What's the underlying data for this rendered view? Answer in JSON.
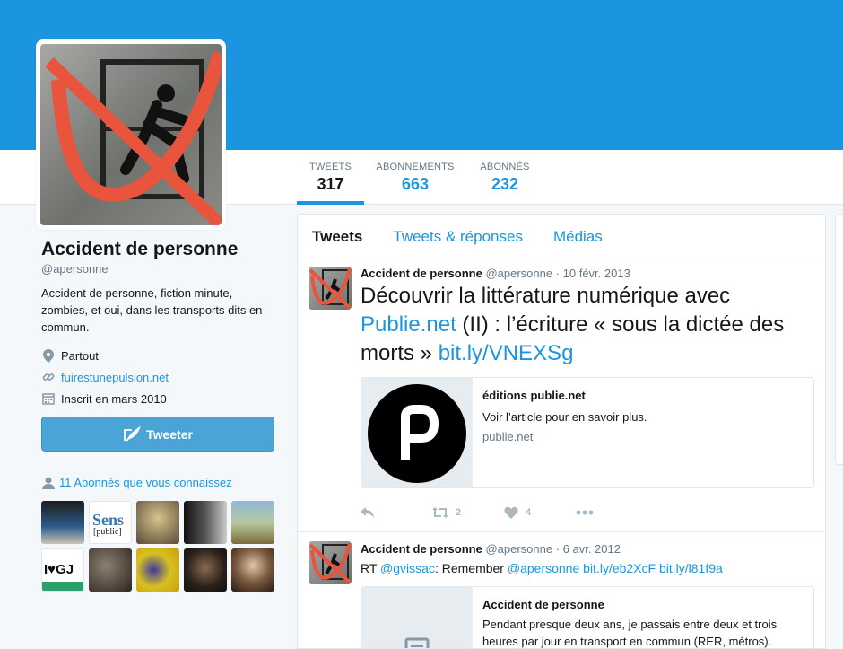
{
  "colors": {
    "brand": "#1b95e0",
    "banner": "#1b95e0",
    "button": "#4aa4d6"
  },
  "nav": {
    "tweets_label": "TWEETS",
    "tweets_count": "317",
    "following_label": "ABONNEMENTS",
    "following_count": "663",
    "followers_label": "ABONNÉS",
    "followers_count": "232"
  },
  "profile": {
    "name": "Accident de personne",
    "handle": "@apersonne",
    "bio": "Accident de personne, fiction minute, zombies, et oui, dans les transports dits en commun.",
    "location": "Partout",
    "website": "fuirestunepulsion.net",
    "joined": "Inscrit en mars 2010",
    "tweet_button": "Tweeter",
    "known_followers": "11 Abonnés que vous connaissez"
  },
  "thumb_texts": {
    "sens": "Sens",
    "public": "[public]",
    "ilove": "I♥GJ"
  },
  "tabs": [
    "Tweets",
    "Tweets & réponses",
    "Médias"
  ],
  "tweets": [
    {
      "name": "Accident de personne",
      "handle": "@apersonne",
      "date": "· 10 févr. 2013",
      "text1": "Découvrir la littérature numérique avec ",
      "link1": "Publie.net",
      "text2": " (II) : l’écriture « sous la dictée des morts » ",
      "link2": "bit.ly/VNEXSg",
      "card": {
        "title": "éditions publie.net",
        "desc": "Voir l’article pour en savoir plus.",
        "url": "publie.net"
      },
      "retweets": "2",
      "likes": "4"
    },
    {
      "name": "Accident de personne",
      "handle": "@apersonne",
      "date": "· 6 avr. 2012",
      "rt": "RT ",
      "mention1": "@gvissac",
      "text1": ": Remember ",
      "mention2": "@apersonne",
      "link1": "bit.ly/eb2XcF",
      "link2": "bit.ly/l81f9a",
      "card": {
        "title": "Accident de personne",
        "desc": "Pendant presque deux ans, je passais entre deux et trois heures par jour en transport en commun (RER, métros)."
      }
    }
  ]
}
